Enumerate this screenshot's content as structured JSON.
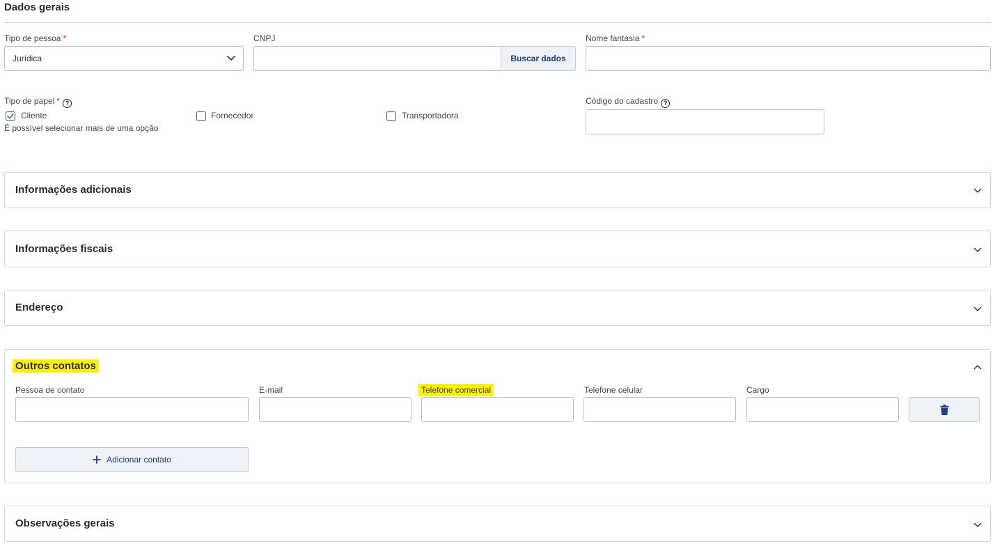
{
  "general": {
    "title": "Dados gerais",
    "tipo_pessoa": {
      "label": "Tipo de pessoa",
      "required": "*",
      "value": "Jurídica"
    },
    "cnpj": {
      "label": "CNPJ",
      "value": "",
      "button": "Buscar dados"
    },
    "nome_fantasia": {
      "label": "Nome fantasia",
      "required": "*",
      "value": ""
    },
    "tipo_papel": {
      "label": "Tipo de papel",
      "required": "*",
      "help": "?",
      "hint": "É possível selecionar mais de uma opção",
      "options": [
        {
          "label": "Cliente",
          "checked": true
        },
        {
          "label": "Fornecedor",
          "checked": false
        },
        {
          "label": "Transportadora",
          "checked": false
        }
      ]
    },
    "codigo_cadastro": {
      "label": "Código do cadastro",
      "help": "?",
      "value": ""
    }
  },
  "panels": {
    "adicionais": "Informações adicionais",
    "fiscais": "Informações fiscais",
    "endereco": "Endereço",
    "contatos": "Outros contatos",
    "observacoes": "Observações gerais"
  },
  "contacts": {
    "fields": {
      "pessoa": "Pessoa de contato",
      "email": "E-mail",
      "telefone_comercial": "Telefone comercial",
      "telefone_celular": "Telefone celular",
      "cargo": "Cargo"
    },
    "add_button": "Adicionar contato"
  },
  "colors": {
    "accent": "#1f3f8a",
    "highlight": "#fff200",
    "required": "#c0262d",
    "border": "#b9bec6",
    "button_bg": "#eef2f7"
  },
  "icons": {
    "select": "chevron-down-icon",
    "help": "help-circle-icon",
    "check": "check-icon",
    "expand": "chevron-down-icon",
    "collapse": "chevron-up-icon",
    "delete": "trash-icon",
    "add": "plus-icon"
  }
}
